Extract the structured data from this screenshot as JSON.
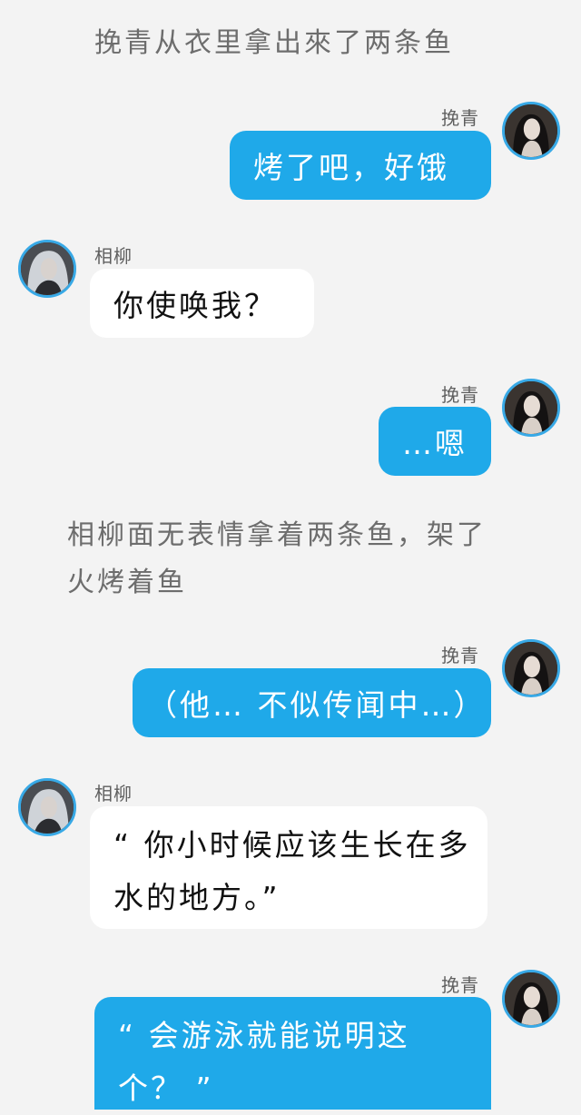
{
  "narrations": [
    "挽青从衣里拿出來了两条鱼",
    "相柳面无表情拿着两条鱼，架了火烤着鱼"
  ],
  "messages": [
    {
      "speaker": "挽青",
      "text": "烤了吧，好饿"
    },
    {
      "speaker": "相柳",
      "text": "你使唤我？"
    },
    {
      "speaker": "挽青",
      "text": "…嗯"
    },
    {
      "speaker": "挽青",
      "text": "（他… 不似传闻中…）"
    },
    {
      "speaker": "相柳",
      "text": "“ 你小时候应该生长在多水的地方。”"
    },
    {
      "speaker": "挽青",
      "text": "“ 会游泳就能说明这个？ ”"
    }
  ],
  "colors": {
    "background": "#f3f3f3",
    "bubble_blue": "#1fa9e9",
    "bubble_white": "#ffffff",
    "avatar_ring": "#38a9e6",
    "narration_text": "#6d6d6d"
  },
  "icons": {
    "wanqing_avatar": "female-portrait-avatar",
    "xiangliu_avatar": "white-haired-male-portrait-avatar"
  }
}
